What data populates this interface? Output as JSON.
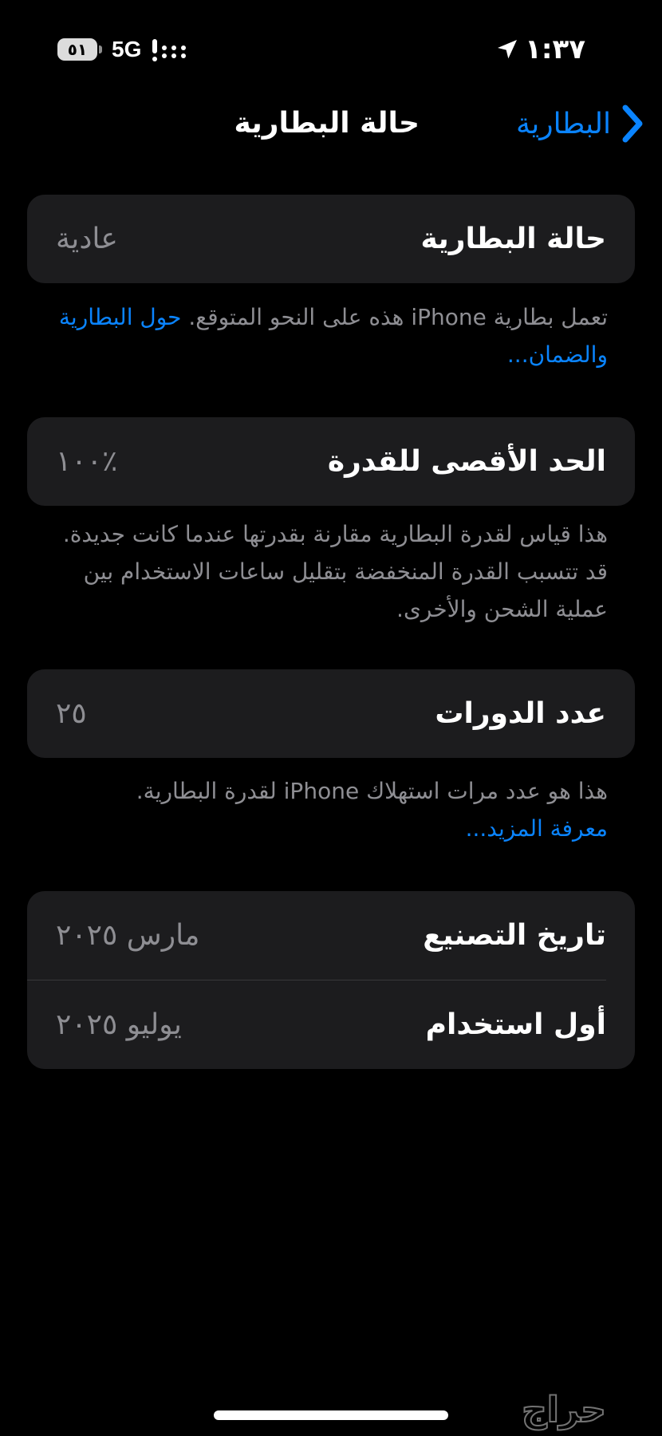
{
  "status_bar": {
    "time": "١:٣٧",
    "network": "5G",
    "battery_level": "٥١",
    "icons": [
      "location-arrow-icon",
      "signal-icon",
      "battery-icon"
    ]
  },
  "nav": {
    "back_label": "البطارية",
    "title": "حالة البطارية"
  },
  "battery_health": {
    "label": "حالة البطارية",
    "value": "عادية",
    "footer_text": "تعمل بطارية iPhone هذه على النحو المتوقع. ",
    "footer_link": "حول البطارية والضمان..."
  },
  "max_capacity": {
    "label": "الحد الأقصى للقدرة",
    "value": "٪١٠٠",
    "footer_text": "هذا قياس لقدرة البطارية مقارنة بقدرتها عندما كانت جديدة. قد تتسبب القدرة المنخفضة بتقليل ساعات الاستخدام بين عملية الشحن والأخرى."
  },
  "cycle_count": {
    "label": "عدد الدورات",
    "value": "٢٥",
    "footer_text": "هذا هو عدد مرات استهلاك iPhone لقدرة البطارية.",
    "footer_link": "معرفة المزيد..."
  },
  "dates": {
    "manufacture_label": "تاريخ التصنيع",
    "manufacture_value": "مارس ٢٠٢٥",
    "first_use_label": "أول استخدام",
    "first_use_value": "يوليو ٢٠٢٥"
  },
  "watermark": "حراج",
  "colors": {
    "accent": "#0a84ff",
    "background": "#000000",
    "card": "#1c1c1e",
    "secondary_text": "#8e8e93"
  }
}
